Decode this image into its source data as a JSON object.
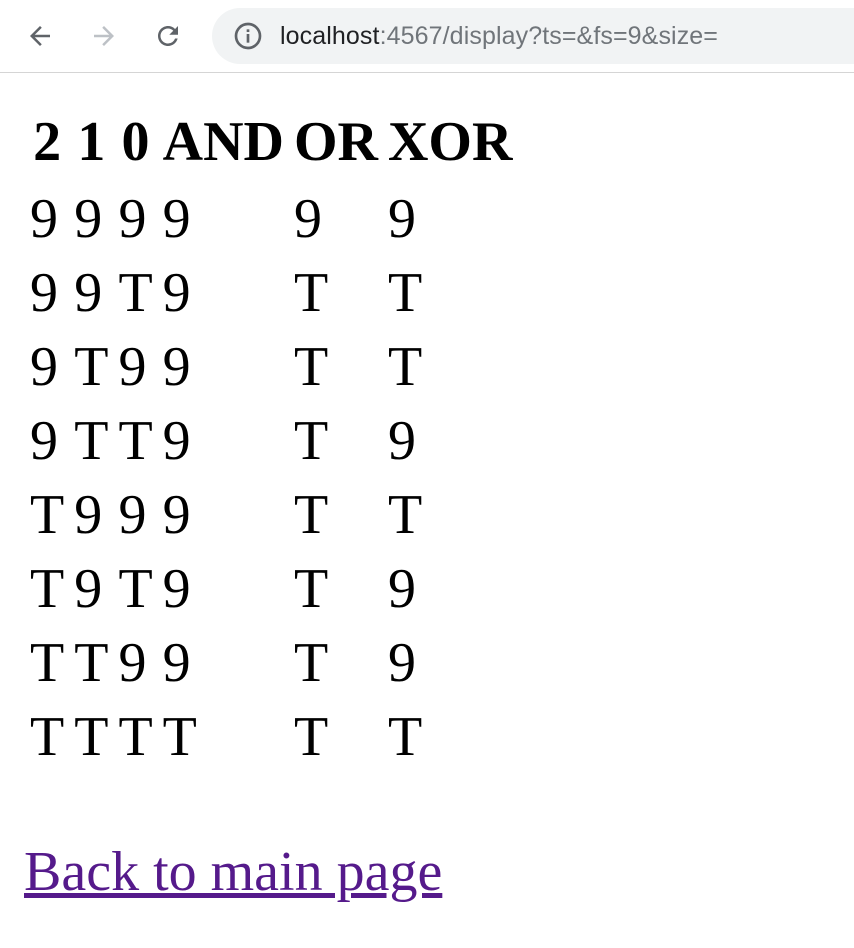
{
  "browser": {
    "url_host": "localhost",
    "url_rest": ":4567/display?ts=&fs=9&size="
  },
  "table": {
    "headers": [
      "2",
      "1",
      "0",
      "AND",
      "OR",
      "XOR"
    ],
    "rows": [
      [
        "9",
        "9",
        "9",
        "9",
        "9",
        "9"
      ],
      [
        "9",
        "9",
        "T",
        "9",
        "T",
        "T"
      ],
      [
        "9",
        "T",
        "9",
        "9",
        "T",
        "T"
      ],
      [
        "9",
        "T",
        "T",
        "9",
        "T",
        "9"
      ],
      [
        "T",
        "9",
        "9",
        "9",
        "T",
        "T"
      ],
      [
        "T",
        "9",
        "T",
        "9",
        "T",
        "9"
      ],
      [
        "T",
        "T",
        "9",
        "9",
        "T",
        "9"
      ],
      [
        "T",
        "T",
        "T",
        "T",
        "T",
        "T"
      ]
    ]
  },
  "back_link": "Back to main page",
  "colors": {
    "link": "#551a8b",
    "toolbar_bg": "#ffffff",
    "omnibox_bg": "#f1f3f4"
  },
  "icons": [
    "back-arrow-icon",
    "forward-arrow-icon",
    "reload-icon",
    "info-icon"
  ]
}
